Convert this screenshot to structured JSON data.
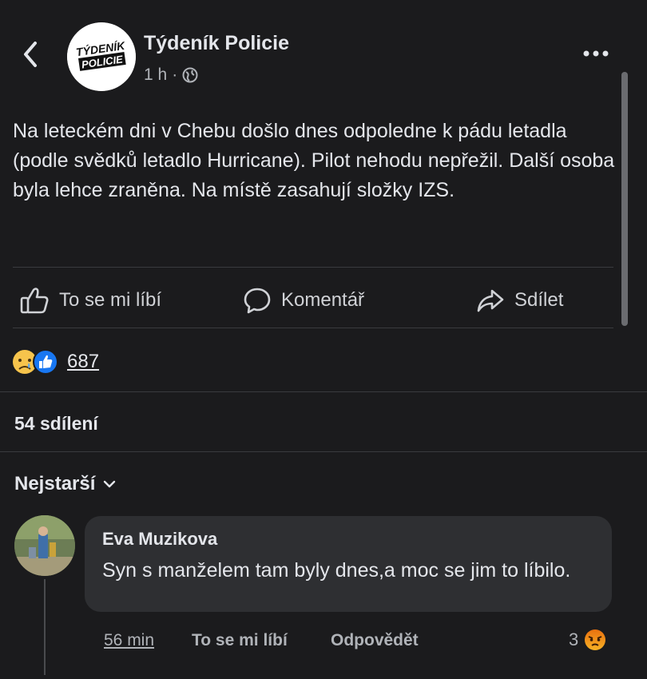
{
  "header": {
    "page_name": "Týdeník Policie",
    "time": "1 h",
    "separator": "·",
    "logo_text_line1": "TÝDENÍK",
    "logo_text_line2": "POLICIE"
  },
  "post": {
    "text": "Na leteckém dni v Chebu došlo dnes odpoledne k pádu letadla (podle svědků letadlo Hurricane). Pilot nehodu nepřežil. Další osoba byla lehce zraněna. Na místě zasahují složky IZS."
  },
  "actions": {
    "like_label": "To se mi líbí",
    "comment_label": "Komentář",
    "share_label": "Sdílet"
  },
  "reactions": {
    "count": "687",
    "types": [
      "sad",
      "like"
    ]
  },
  "shares": {
    "label": "54 sdílení"
  },
  "comments": {
    "sort_label": "Nejstarší",
    "items": [
      {
        "author": "Eva Muzikova",
        "text": "Syn s manželem tam byly dnes,a moc se jim to líbilo.",
        "time": "56 min",
        "like_label": "To se mi líbí",
        "reply_label": "Odpovědět",
        "reaction_count": "3",
        "reaction_type": "angry"
      }
    ]
  },
  "colors": {
    "background": "#1b1b1d",
    "bubble": "#2e2f32",
    "text": "#e4e6eb",
    "secondary": "#b0b3b8",
    "like_blue": "#1877f2",
    "sad_yellow": "#f7c44c",
    "angry_orange": "#e9710f"
  }
}
